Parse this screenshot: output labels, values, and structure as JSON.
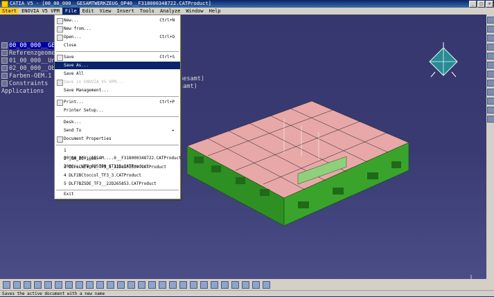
{
  "window": {
    "title": "CATIA V5 - [00_00_000__GESAMTWERKZEUG_OP40__F318000348722.CATProduct]"
  },
  "menubar": {
    "items": [
      "Start",
      "ENOVIA V5 VPM",
      "File",
      "Edit",
      "View",
      "Insert",
      "Tools",
      "Analyze",
      "Window",
      "Help"
    ]
  },
  "file_menu": {
    "items": [
      {
        "label": "New...",
        "shortcut": "Ctrl+N"
      },
      {
        "label": "New from...",
        "shortcut": ""
      },
      {
        "label": "Open...",
        "shortcut": "Ctrl+O"
      },
      {
        "label": "Close",
        "shortcut": ""
      },
      {
        "label": "Save",
        "shortcut": "Ctrl+S"
      },
      {
        "label": "Save As...",
        "shortcut": ""
      },
      {
        "label": "Save All",
        "shortcut": ""
      },
      {
        "label": "Save in ENOVIA V5 VPM...",
        "shortcut": ""
      },
      {
        "label": "Save Management...",
        "shortcut": ""
      },
      {
        "label": "Print...",
        "shortcut": "Ctrl+P"
      },
      {
        "label": "Printer Setup...",
        "shortcut": ""
      },
      {
        "label": "Desk...",
        "shortcut": ""
      },
      {
        "label": "Send To",
        "shortcut": "▸"
      },
      {
        "label": "Document Properties",
        "shortcut": ""
      },
      {
        "label": "1 00_00_000__GESAM....0__F318000348722.CATProduct",
        "shortcut": ""
      },
      {
        "label": "2 TGM_ZC-1600-2000...UFB_CUSION_ST115.CATProduct",
        "shortcut": ""
      },
      {
        "label": "3 DLF6CNEYOPE_TF3_S_32D8272630.CATProduct",
        "shortcut": ""
      },
      {
        "label": "4 DLF2BCtoccol_TF3_3.CATProduct",
        "shortcut": ""
      },
      {
        "label": "5 DLF7BZSDE_TF3__22D265853.CATProduct",
        "shortcut": ""
      },
      {
        "label": "Exit",
        "shortcut": ""
      }
    ]
  },
  "tree": {
    "root": "00_00_000__GESA",
    "items": [
      "Referenzgeome",
      "01_00_000__Un",
      "02_00_000__Ob",
      "Farben-OEM.1",
      "Constraints",
      "Applications"
    ],
    "hidden_suffix_1": "_Gesamt)",
    "hidden_suffix_2": "esamt)"
  },
  "status": {
    "text": "Saves the active document with a new name"
  },
  "colors": {
    "viewport_bg": "#393a72",
    "model_green": "#2e8f22",
    "model_pink": "#e8a8a8",
    "menu_highlight": "#0a246a"
  }
}
